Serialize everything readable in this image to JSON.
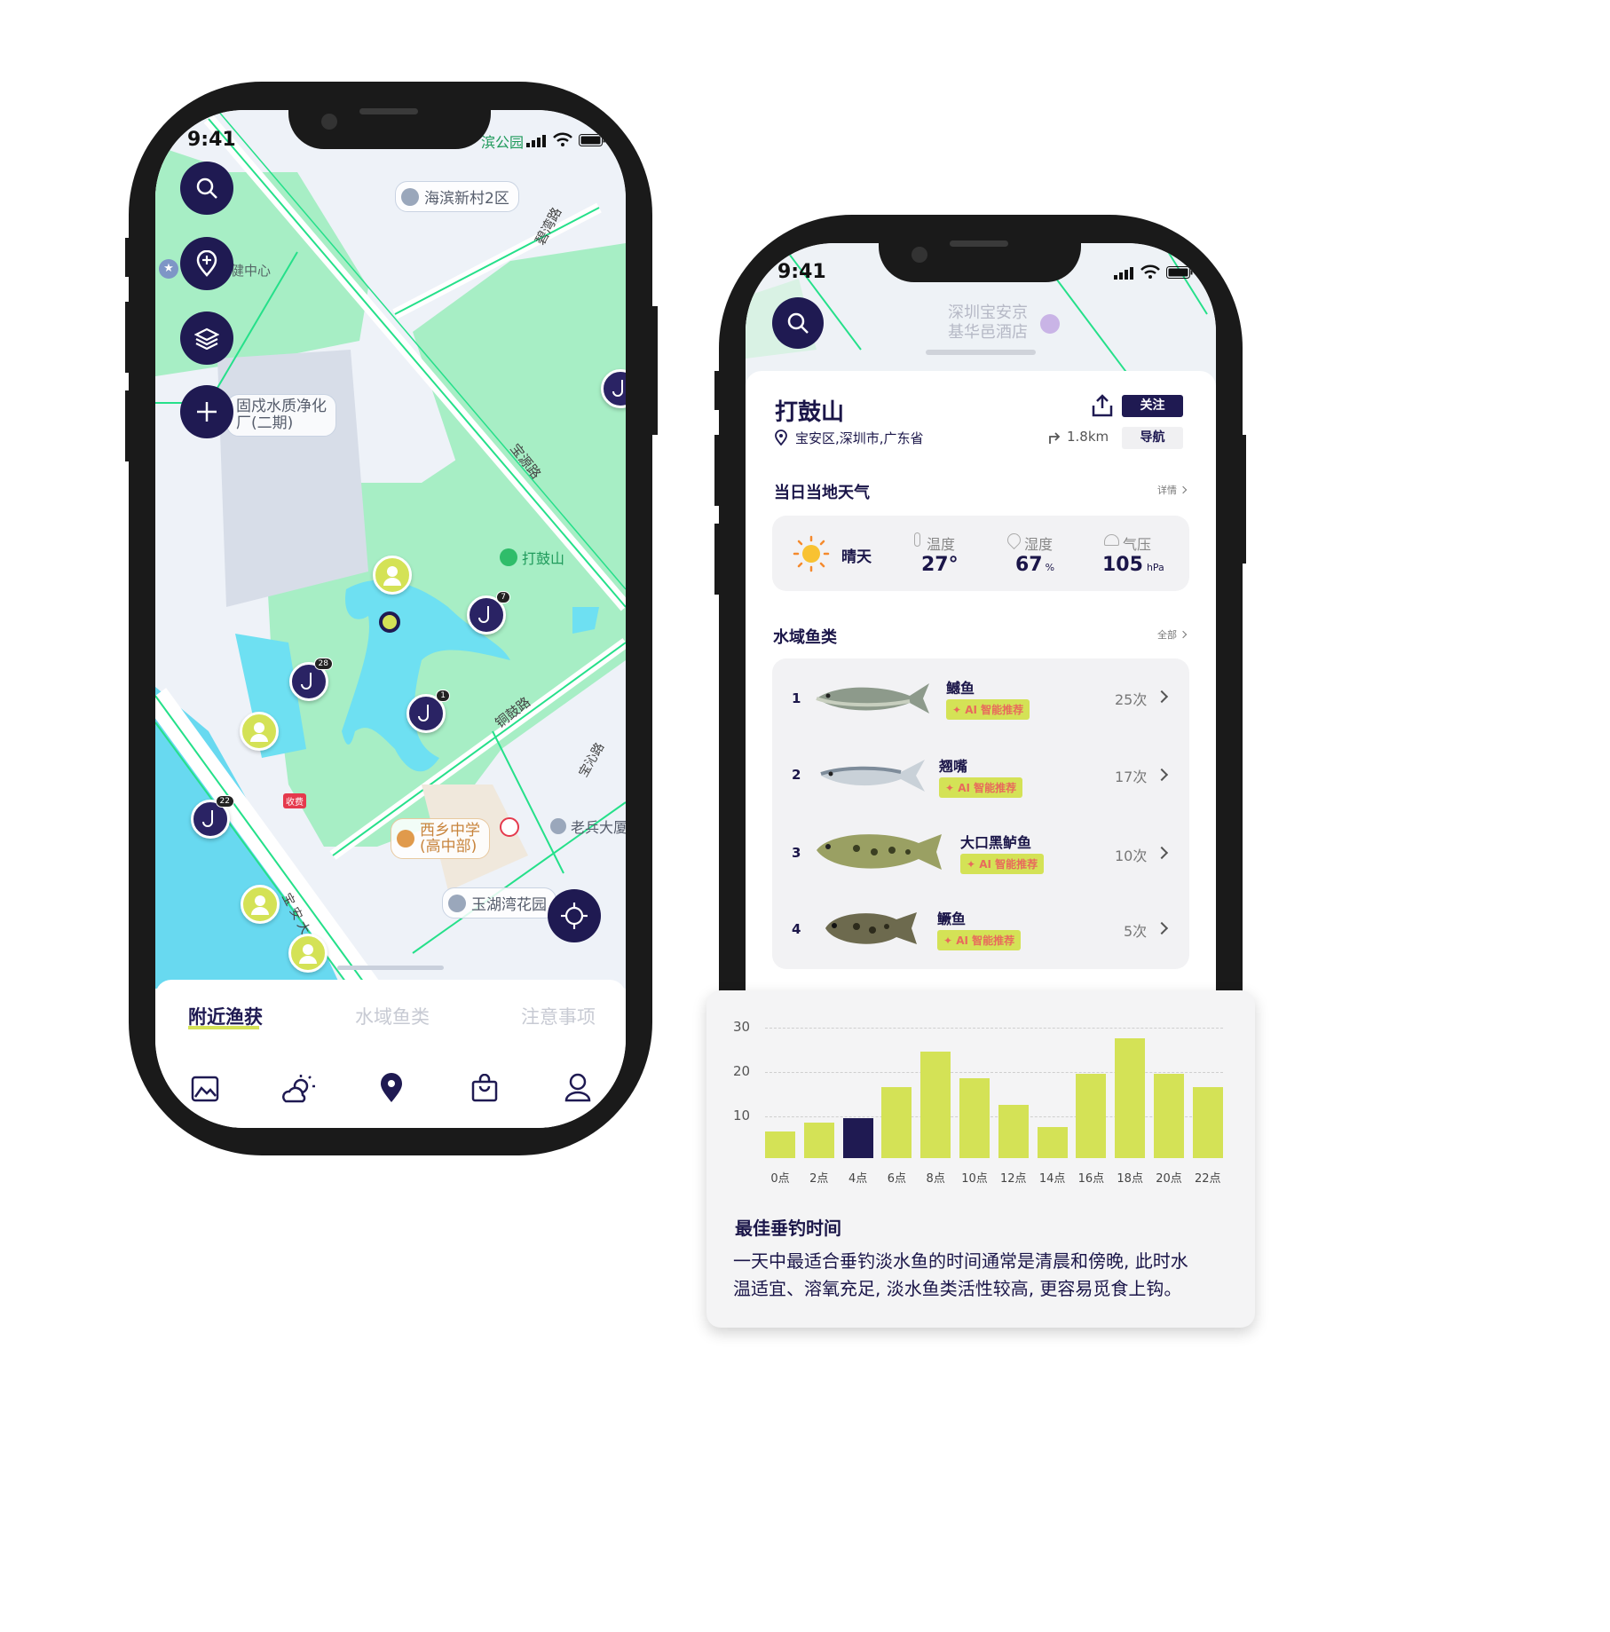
{
  "left_phone": {
    "status": {
      "time": "9:41",
      "poi_top": "滨公园"
    },
    "map": {
      "labels": {
        "haibin": "海滨新村2区",
        "center": "健中心",
        "guchuan_1": "固戍水质净化",
        "guchuan_2": "厂(二期)",
        "dagushan": "打鼓山",
        "baoyuan_road": "宝源路",
        "biwan_road": "碧湾路",
        "tonggu_road": "铜鼓路",
        "baoqin_road": "宝沁路",
        "xixiang_1": "西乡中学",
        "xixiang_2": "(高中部)",
        "laobing": "老兵大厦",
        "yuhu": "玉湖湾花园",
        "toll": "收费",
        "dadao": "宝安大道"
      },
      "pin_counts": [
        "7",
        "28",
        "1",
        "22"
      ]
    },
    "tabs": [
      "附近渔获",
      "水域鱼类",
      "注意事项"
    ],
    "active_tab": "附近渔获",
    "nav_icons": [
      "gallery-icon",
      "weather-icon",
      "map-pin-icon",
      "bag-icon",
      "profile-icon"
    ]
  },
  "right_phone": {
    "status": {
      "time": "9:41"
    },
    "map": {
      "hotel_1": "深圳宝安京",
      "hotel_2": "基华邑酒店"
    },
    "place": {
      "name": "打鼓山",
      "follow_label": "关注",
      "address": "宝安区,深圳市,广东省",
      "distance": "1.8km",
      "nav_label": "导航"
    },
    "weather": {
      "section_title": "当日当地天气",
      "more": "详情",
      "condition": "晴天",
      "temp_label": "温度",
      "temp_value": "27°",
      "humidity_label": "湿度",
      "humidity_value": "67",
      "humidity_unit": "%",
      "pressure_label": "气压",
      "pressure_value": "105",
      "pressure_unit": "hPa"
    },
    "fish": {
      "section_title": "水域鱼类",
      "more": "全部",
      "ai_label": "✦ AI 智能推荐",
      "items": [
        {
          "rank": "1",
          "name": "鳡鱼",
          "count": "25次"
        },
        {
          "rank": "2",
          "name": "翘嘴",
          "count": "17次"
        },
        {
          "rank": "3",
          "name": "大口黑鲈鱼",
          "count": "10次"
        },
        {
          "rank": "4",
          "name": "鳜鱼",
          "count": "5次"
        }
      ]
    }
  },
  "card": {
    "title": "最佳垂钓时间",
    "description_1": "一天中最适合垂钓淡水鱼的时间通常是清晨和傍晚, 此时水",
    "description_2": "温适宜、溶氧充足, 淡水鱼类活性较高, 更容易觅食上钩。"
  },
  "colors": {
    "accent": "#d4e256",
    "primary": "#1f1a52",
    "highlight_bar": "#1f1a52"
  },
  "chart_data": {
    "type": "bar",
    "categories": [
      "0点",
      "2点",
      "4点",
      "6点",
      "8点",
      "10点",
      "12点",
      "14点",
      "16点",
      "18点",
      "20点",
      "22点"
    ],
    "values": [
      6,
      8,
      9,
      16,
      24,
      18,
      12,
      7,
      19,
      27,
      19,
      16
    ],
    "highlight_index": 2,
    "ylim": [
      0,
      30
    ],
    "yticks": [
      10,
      20,
      30
    ],
    "grid": true
  }
}
